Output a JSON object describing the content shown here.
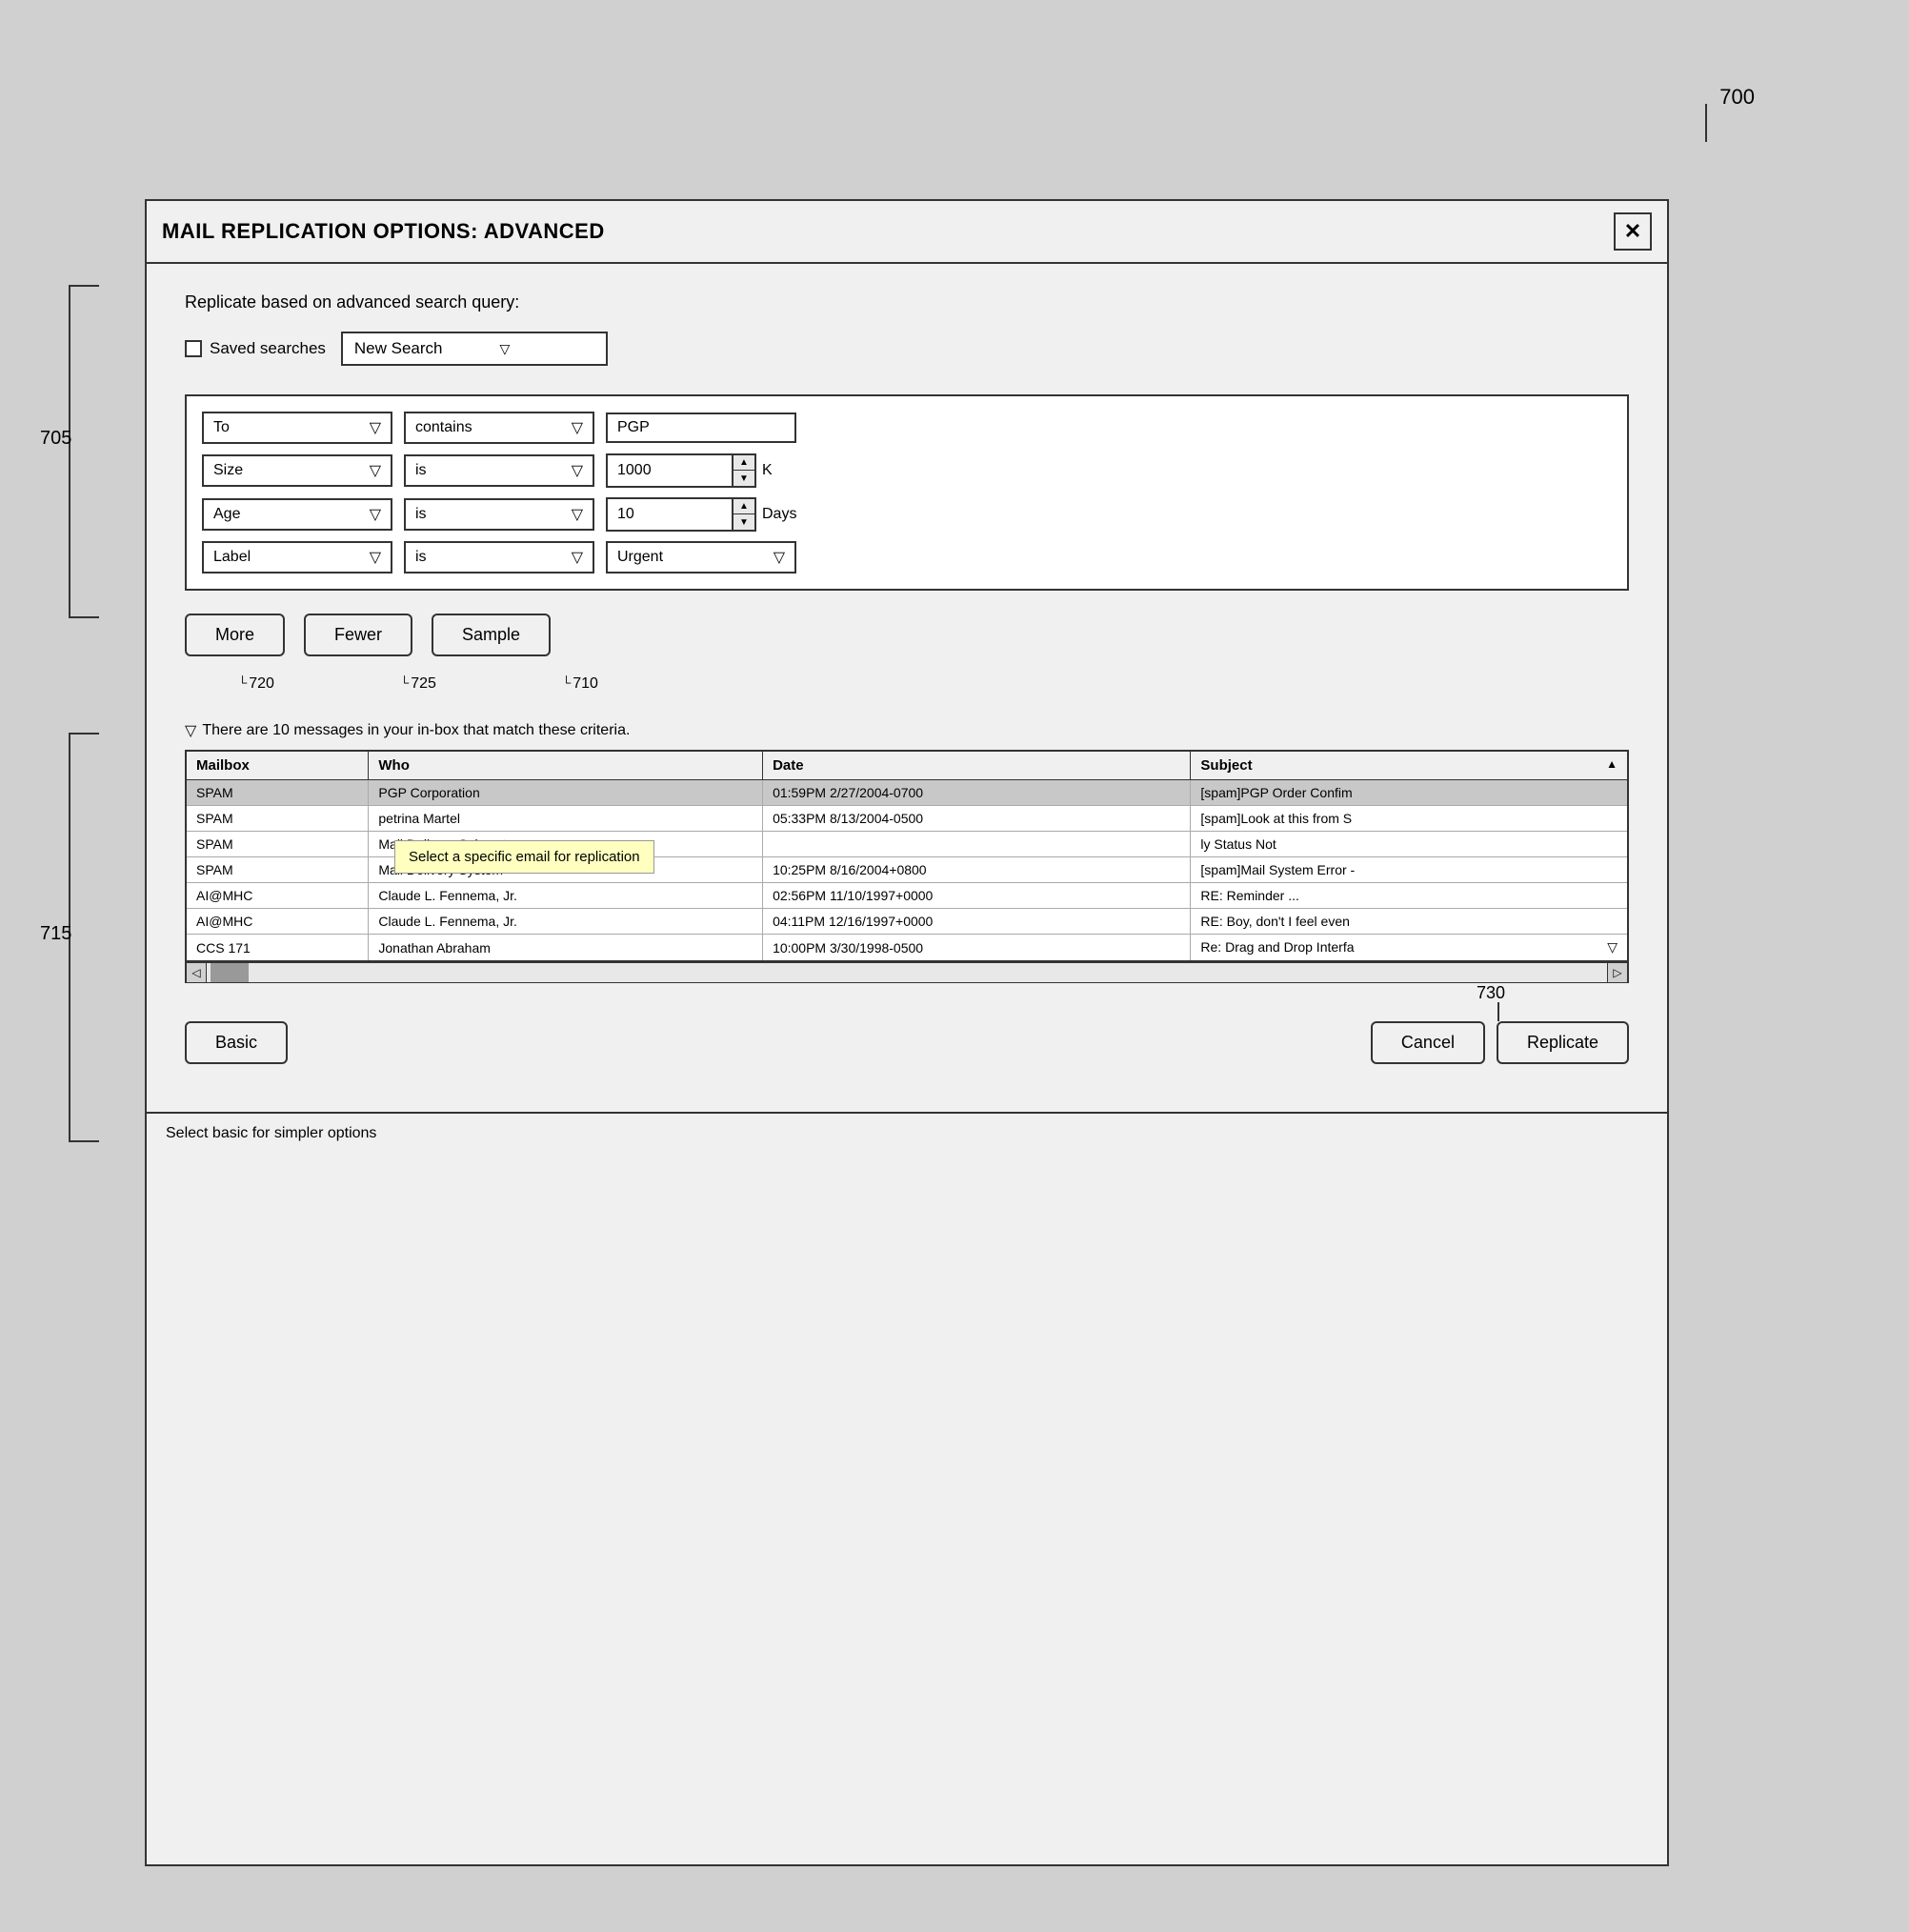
{
  "diagram": {
    "label_top": "700",
    "label_705": "705",
    "label_715": "715",
    "label_730": "730",
    "label_720": "720",
    "label_725": "725",
    "label_710": "710"
  },
  "window": {
    "title": "MAIL REPLICATION OPTIONS: ADVANCED",
    "close_label": "✕"
  },
  "header": {
    "replicate_label": "Replicate based on advanced search query:",
    "saved_searches_label": "Saved searches",
    "search_value": "New Search"
  },
  "criteria": {
    "rows": [
      {
        "field": "To",
        "operator": "contains",
        "value_type": "text",
        "value": "PGP"
      },
      {
        "field": "Size",
        "operator": "is",
        "value_type": "spinner",
        "value": "1000",
        "unit": "K"
      },
      {
        "field": "Age",
        "operator": "is",
        "value_type": "spinner",
        "value": "10",
        "unit": "Days"
      },
      {
        "field": "Label",
        "operator": "is",
        "value_type": "dropdown",
        "value": "Urgent"
      }
    ]
  },
  "buttons": {
    "more": "More",
    "fewer": "Fewer",
    "sample": "Sample"
  },
  "match_info": {
    "icon": "▽",
    "text": "There are 10 messages in your in-box that match these criteria."
  },
  "table": {
    "columns": [
      "Mailbox",
      "Who",
      "Date",
      "Subject"
    ],
    "rows": [
      {
        "mailbox": "SPAM",
        "who": "PGP Corporation",
        "date": "01:59PM 2/27/2004-0700",
        "subject": "[spam]PGP Order Confim",
        "highlighted": true
      },
      {
        "mailbox": "SPAM",
        "who": "petrina Martel",
        "date": "05:33PM 8/13/2004-0500",
        "subject": "[spam]Look at this from S",
        "highlighted": false
      },
      {
        "mailbox": "SPAM",
        "who": "Mail Delivery Subsystem",
        "date": "",
        "subject": "ly Status Not",
        "highlighted": false,
        "tooltip_row": true
      },
      {
        "mailbox": "SPAM",
        "who": "Mail Delivery System",
        "date": "10:25PM 8/16/2004+0800",
        "subject": "[spam]Mail System Error -",
        "highlighted": false
      },
      {
        "mailbox": "AI@MHC",
        "who": "Claude L. Fennema, Jr.",
        "date": "02:56PM 11/10/1997+0000",
        "subject": "RE: Reminder ...",
        "highlighted": false
      },
      {
        "mailbox": "AI@MHC",
        "who": "Claude L. Fennema, Jr.",
        "date": "04:11PM 12/16/1997+0000",
        "subject": "RE: Boy, don't I feel even",
        "highlighted": false
      },
      {
        "mailbox": "CCS 171",
        "who": "Jonathan Abraham",
        "date": "10:00PM 3/30/1998-0500",
        "subject": "Re: Drag and Drop Interfa",
        "highlighted": false
      }
    ],
    "tooltip": "Select a specific email for replication"
  },
  "bottom_buttons": {
    "basic": "Basic",
    "cancel": "Cancel",
    "replicate": "Replicate"
  },
  "footer": {
    "text": "Select basic for simpler options"
  }
}
